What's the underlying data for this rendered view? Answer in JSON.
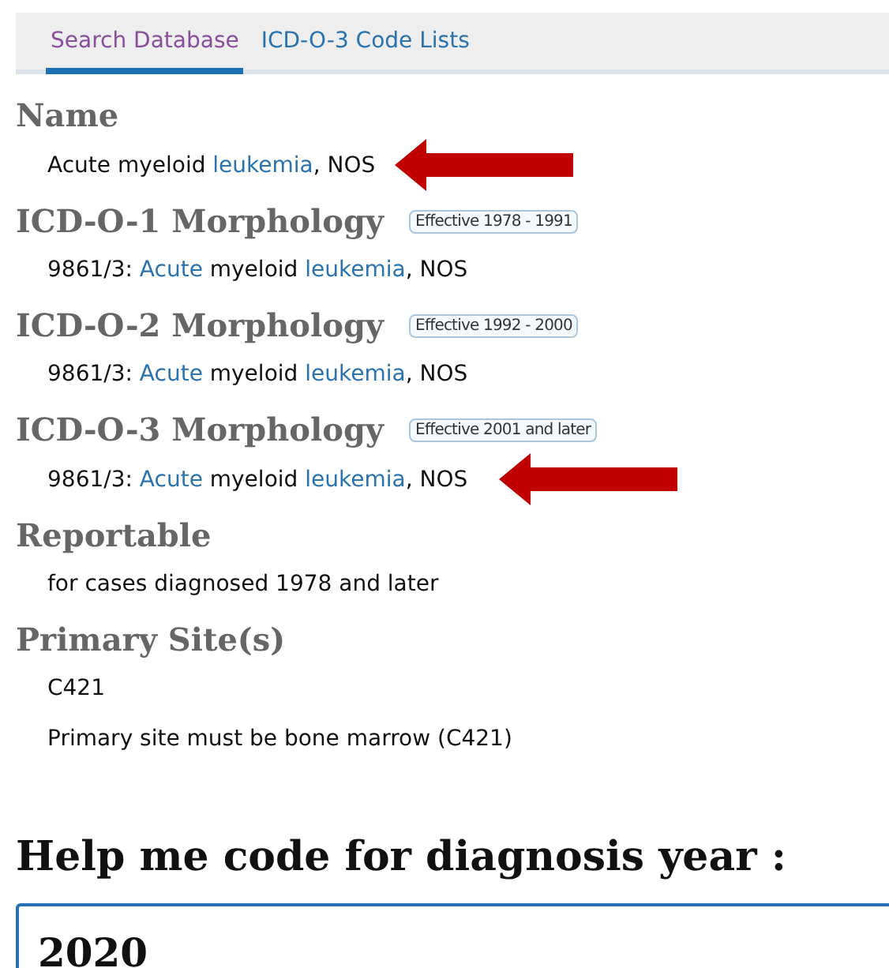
{
  "tabs": [
    {
      "label": "Search Database",
      "selected": true
    },
    {
      "label": "ICD-O-3 Code Lists",
      "selected": false
    }
  ],
  "sections": [
    {
      "title": "Name",
      "pointer_arrow": true,
      "lines": [
        [
          {
            "text": "Acute myeloid ",
            "link": false
          },
          {
            "text": "leukemia",
            "link": true
          },
          {
            "text": ", NOS",
            "link": false
          }
        ]
      ]
    },
    {
      "title": "ICD-O-1 Morphology",
      "badge": "Effective 1978 - 1991",
      "pointer_arrow": false,
      "lines": [
        [
          {
            "text": "9861/3: ",
            "link": false
          },
          {
            "text": "Acute",
            "link": true
          },
          {
            "text": " myeloid ",
            "link": false
          },
          {
            "text": "leukemia",
            "link": true
          },
          {
            "text": ", NOS",
            "link": false
          }
        ]
      ]
    },
    {
      "title": "ICD-O-2 Morphology",
      "badge": "Effective 1992 - 2000",
      "pointer_arrow": false,
      "lines": [
        [
          {
            "text": "9861/3: ",
            "link": false
          },
          {
            "text": "Acute",
            "link": true
          },
          {
            "text": " myeloid ",
            "link": false
          },
          {
            "text": "leukemia",
            "link": true
          },
          {
            "text": ", NOS",
            "link": false
          }
        ]
      ]
    },
    {
      "title": "ICD-O-3 Morphology",
      "badge": "Effective 2001 and later",
      "pointer_arrow": true,
      "lines": [
        [
          {
            "text": "9861/3: ",
            "link": false
          },
          {
            "text": "Acute",
            "link": true
          },
          {
            "text": " myeloid ",
            "link": false
          },
          {
            "text": "leukemia",
            "link": true
          },
          {
            "text": ", NOS",
            "link": false
          }
        ]
      ]
    },
    {
      "title": "Reportable",
      "pointer_arrow": false,
      "lines": [
        [
          {
            "text": "for cases diagnosed 1978 and later",
            "link": false
          }
        ]
      ]
    },
    {
      "title": "Primary Site(s)",
      "pointer_arrow": false,
      "lines": [
        [
          {
            "text": "C421",
            "link": false
          }
        ],
        [
          {
            "text": "Primary site must be bone marrow (C421)",
            "link": false
          }
        ]
      ]
    }
  ],
  "help": {
    "title": "Help me code for diagnosis year :",
    "year_value": "2020"
  }
}
